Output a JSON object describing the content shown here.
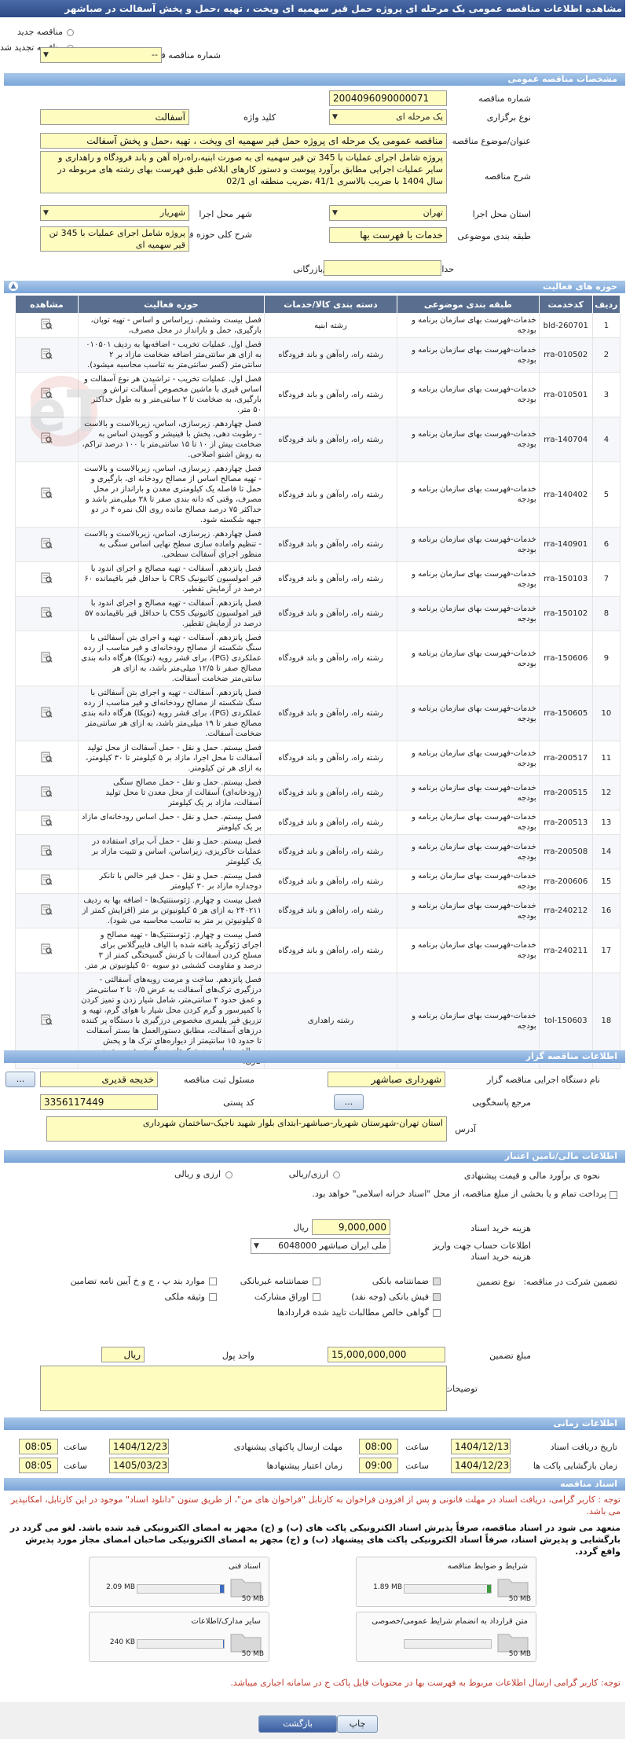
{
  "page_title": "مشاهده اطلاعات مناقصه عمومی یک مرحله ای پروژه حمل قیر سهمیه ای ویخت ، تهیه ،حمل و پخش آسفالت در صباشهر",
  "top": {
    "new_tender_label": "مناقصه جدید",
    "renewed_label": "مناقصه تجدید شده",
    "prev_number_label": "شماره مناقصه قبلی",
    "prev_number_value": "--"
  },
  "general": {
    "section": "مشخصات مناقصه عمومی",
    "number_label": "شماره مناقصه",
    "number_value": "2004096090000071",
    "type_label": "نوع برگزاری",
    "type_value": "یک مرحله ای",
    "keyword_label": "کلید واژه",
    "keyword_value": "آسفالت",
    "subject_label": "عنوان/موضوع مناقصه",
    "subject_value": "مناقصه عمومی یک مرحله ای پروژه حمل قیر سهمیه ای ویخت ، تهیه ،حمل و پخش آسفالت",
    "desc_label": "شرح مناقصه",
    "desc_value": "پروژه شامل اجرای عملیات با 345 تن قیر سهمیه ای به صورت ابنیه،راه،راه آهن و باند فرودگاه و راهداری و سایر عملیات اجرایی مطابق برآورد پیوست و دستور کارهای ابلاغی طبق فهرست بهای رشته های مربوطه در سال 1404 با ضریب بالاسری 41/1 ،ضریب منطقه ای 02/1",
    "province_label": "استان محل اجرا",
    "province_value": "تهران",
    "city_label": "شهر محل اجرا",
    "city_value": "شهریار",
    "category_label": "طبقه بندی موضوعی",
    "category_value": "خدمات با فهرست بها",
    "scope_label": "شرح کلی حوزه فعالیت",
    "scope_value": "پروژه شامل اجرای عملیات با 345 تن قیر سهمیه ای",
    "min_score_label": "حداقل امتیاز قابل قبول ارزیابی فنی/بازرگانی",
    "min_score_value": ""
  },
  "activities": {
    "section": "حوزه های فعالیت",
    "headers": [
      "ردیف",
      "کدخدمت",
      "طبقه بندی موضوعی",
      "دسته بندی کالا/خدمات",
      "حوزه فعالیت",
      "مشاهده"
    ],
    "rows": [
      {
        "idx": "1",
        "code": "bld-260701",
        "cat": "خدمات-فهرست بهای سازمان برنامه و بودجه",
        "grp": "رشته ابنیه",
        "act": "فصل بیست وششم. زیراساس و اساس - تهیه توپان، بارگیری، حمل و بارانداز در محل مصرف،"
      },
      {
        "idx": "2",
        "code": "rra-010502",
        "cat": "خدمات-فهرست بهای سازمان برنامه و بودجه",
        "grp": "رشته راه، راه‌آهن و باند فرودگاه",
        "act": "فصل اول. عملیات تخریب - اضافه‌بها به ردیف ۰۱۰۵۰۱ به ازای هر سانتی‌متر اضافه ضخامت مازاد بر ۲ سانتی‌متر (کسر سانتی‌متر به تناسب محاسبه میشود)."
      },
      {
        "idx": "3",
        "code": "rra-010501",
        "cat": "خدمات-فهرست بهای سازمان برنامه و بودجه",
        "grp": "رشته راه، راه‌آهن و باند فرودگاه",
        "act": "فصل اول. عملیات تخریب - تراشیدن هر نوع آسفالت و اساس قیری با ماشین مخصوص آسفالت تراش و بارگیری، به ضخامت تا ۲ سانتی‌متر و به طول حداکثر ۵۰ متر."
      },
      {
        "idx": "4",
        "code": "rra-140704",
        "cat": "خدمات-فهرست بهای سازمان برنامه و بودجه",
        "grp": "رشته راه، راه‌آهن و باند فرودگاه",
        "act": "فصل چهاردهم. زیرسازی، اساس، زیربالاست و بالاست - رطوبت دهی، پخش با فینیشر و کوبیدن اساس به ضخامت بیش از ۱۰ تا ۱۵ سانتی‌متر با ۱۰۰ درصد تراکم، به روش اشنو اصلاحی."
      },
      {
        "idx": "5",
        "code": "rra-140402",
        "cat": "خدمات-فهرست بهای سازمان برنامه و بودجه",
        "grp": "رشته راه، راه‌آهن و باند فرودگاه",
        "act": "فصل چهاردهم. زیرسازی، اساس، زیربالاست و بالاست - تهیه مصالح اساس از مصالح رودخانه ای، بارگیری و حمل تا فاصله یک کیلومتری معدن و بارانداز در محل مصرف، وقتی که دانه بندی صفر تا ۳۸ میلی‌متر باشد و حداکثر ۷۵ درصد مصالح مانده روی الک نمره ۴ در دو جبهه شکسته شود."
      },
      {
        "idx": "6",
        "code": "rra-140901",
        "cat": "خدمات-فهرست بهای سازمان برنامه و بودجه",
        "grp": "رشته راه، راه‌آهن و باند فرودگاه",
        "act": "فصل چهاردهم. زیرسازی، اساس، زیربالاست و بالاست - تنظیم واماده سازی سطح نهایی اساس سنگی به منظور اجرای آسفالت سطحی."
      },
      {
        "idx": "7",
        "code": "rra-150103",
        "cat": "خدمات-فهرست بهای سازمان برنامه و بودجه",
        "grp": "رشته راه، راه‌آهن و باند فرودگاه",
        "act": "فصل پانزدهم. آسفالت - تهیه مصالح و اجرای اندود با قیر امولسیون کاتیونیک CRS با حداقل قیر باقیمانده ۶۰ درصد در آزمایش تقطیر."
      },
      {
        "idx": "8",
        "code": "rra-150102",
        "cat": "خدمات-فهرست بهای سازمان برنامه و بودجه",
        "grp": "رشته راه، راه‌آهن و باند فرودگاه",
        "act": "فصل پانزدهم. آسفالت - تهیه مصالح و اجرای اندود با قیر امولسیون کاتیونیک CSS با حداقل قیر باقیمانده ۵۷ درصد در آزمایش تقطیر."
      },
      {
        "idx": "9",
        "code": "rra-150606",
        "cat": "خدمات-فهرست بهای سازمان برنامه و بودجه",
        "grp": "رشته راه، راه‌آهن و باند فرودگاه",
        "act": "فصل پانزدهم. آسفالت - تهیه و اجرای بتن آسفالتی با سنگ شکسته از مصالح رودخانه‌ای و قیر مناسب از رده عملکردی (PG)، برای قشر رویه (توپکا) هرگاه دانه بندی مصالح صفر تا ۱۲/۵ میلی‌متر باشد، به ازای هر سانتی‌متر ضخامت آسفالت."
      },
      {
        "idx": "10",
        "code": "rra-150605",
        "cat": "خدمات-فهرست بهای سازمان برنامه و بودجه",
        "grp": "رشته راه، راه‌آهن و باند فرودگاه",
        "act": "فصل پانزدهم. آسفالت - تهیه و اجرای بتن آسفالتی با سنگ شکسته از مصالح رودخانه‌ای و قیر مناسب از رده عملکردی (PG)، برای قشر رویه (توپکا) هرگاه دانه بندی مصالح صفر تا ۱۹ میلی‌متر باشد، به ازای هر سانتی‌متر ضخامت آسفالت."
      },
      {
        "idx": "11",
        "code": "rra-200517",
        "cat": "خدمات-فهرست بهای سازمان برنامه و بودجه",
        "grp": "رشته راه، راه‌آهن و باند فرودگاه",
        "act": "فصل بیستم. حمل و نقل - حمل آسفالت از محل تولید آسفالت تا محل اجرا، مازاد بر ۵ کیلومتر تا ۳۰ کیلومتر، به ازای هر تن کیلومتر."
      },
      {
        "idx": "12",
        "code": "rra-200515",
        "cat": "خدمات-فهرست بهای سازمان برنامه و بودجه",
        "grp": "رشته راه، راه‌آهن و باند فرودگاه",
        "act": "فصل بیستم. حمل و نقل - حمل مصالح سنگی (رودخانه‌ای) آسفالت از محل معدن تا محل تولید آسفالت، مازاد بر یک کیلومتر"
      },
      {
        "idx": "13",
        "code": "rra-200513",
        "cat": "خدمات-فهرست بهای سازمان برنامه و بودجه",
        "grp": "رشته راه، راه‌آهن و باند فرودگاه",
        "act": "فصل بیستم. حمل و نقل - حمل اساس رودخانه‌ای مازاد بر یک کیلومتر"
      },
      {
        "idx": "14",
        "code": "rra-200508",
        "cat": "خدمات-فهرست بهای سازمان برنامه و بودجه",
        "grp": "رشته راه، راه‌آهن و باند فرودگاه",
        "act": "فصل بیستم. حمل و نقل - حمل آب برای استفاده در عملیات خاکریزی، زیراساس، اساس و تثبیت مازاد بر یک کیلومتر"
      },
      {
        "idx": "15",
        "code": "rra-200606",
        "cat": "خدمات-فهرست بهای سازمان برنامه و بودجه",
        "grp": "رشته راه، راه‌آهن و باند فرودگاه",
        "act": "فصل بیستم. حمل و نقل - حمل قیر خالص با تانکر دوجداره مازاد بر ۳۰ کیلومتر"
      },
      {
        "idx": "16",
        "code": "rra-240212",
        "cat": "خدمات-فهرست بهای سازمان برنامه و بودجه",
        "grp": "رشته راه، راه‌آهن و باند فرودگاه",
        "act": "فصل بیست و چهارم. ژئوسنتتیک‌ها - اضافه بها به ردیف ۲۴۰۲۱۱ به ازای هر ۵ کیلونیوتن بر متر (افزایش کمتر از ۵ کیلونیوتن بر متر به تناسب محاسبه می شود)."
      },
      {
        "idx": "17",
        "code": "rra-240211",
        "cat": "خدمات-فهرست بهای سازمان برنامه و بودجه",
        "grp": "رشته راه، راه‌آهن و باند فرودگاه",
        "act": "فصل بیست و چهارم. ژئوسنتتیک‌ها - تهیه مصالح و اجرای ژئوگرید بافته شده با الیاف فایبرگلاس برای مسلح کردن آسفالت با کرنش گسیختگی کمتر از ۳ درصد و مقاومت کششی دو سویه ۵۰ کیلونیوتن بر متر."
      },
      {
        "idx": "18",
        "code": "tol-150603",
        "cat": "خدمات-فهرست بهای سازمان برنامه و بودجه",
        "grp": "رشته راهداری",
        "act": "فصل پانزدهم. ساخت و مرمت رویه‌های آسفالتی - درزگیری ترک‌های آسفالت به عرض ۰/۵ تا ۲ سانتی‌متر و عمق حدود ۲ سانتی‌متر، شامل شیار زدن و تمیز کردن با کمپرسور و گرم کردن محل شیار با هوای گرم، تهیه و تزریق قیر پلیمری مخصوص درزگیری با دستگاه پر کننده درزهای آسفالت، مطابق دستورالعمل ها بستر آسفالت تا حدود ۱۵ سانتیمتر از دیواره‌های ترک ها و پخش مصالح ریزدانه روی ترک‌های درزگیری شده و تمیز کاری."
      }
    ]
  },
  "organizer": {
    "section": "اطلاعات مناقصه گزار",
    "org_label": "نام دستگاه اجرایی مناقصه گزار",
    "org_value": "شهرداری صباشهر",
    "responsible_label": "مسئول ثبت مناقصه",
    "responsible_value": "خدیجه قدیری",
    "ref_label": "مرجع پاسخگویی",
    "postal_label": "کد پستی",
    "postal_value": "3356117449",
    "address_label": "آدرس",
    "address_value": "استان تهران-شهرستان شهریار-صباشهر-ابتدای بلوار شهید ناجیک-ساختمان شهرداری",
    "btn": "..."
  },
  "finance": {
    "section": "اطلاعات مالی/تامین اعتبار",
    "estimate_label": "نحوه ی برآورد مالی و قیمت پیشنهادی",
    "estimate_opt1": "ارزی/ریالی",
    "estimate_opt2": "ارزی و ریالی",
    "payment_label": "پرداخت تمام و یا بخشی از مبلغ مناقصه، از محل \"اسناد خزانه اسلامی\" خواهد بود.",
    "doc_price_label": "هزینه خرید اسناد",
    "doc_price_value": "9,000,000",
    "doc_price_unit": "ریال",
    "account_label": "اطلاعات حساب جهت واریز هزینه خرید اسناد",
    "account_value": "ملی ایران صباشهر 6048000",
    "guarantee_label": "نوع تضمین",
    "guarantee_intro": "تضمین شرکت در مناقصه:",
    "guarantees": [
      "ضمانتنامه بانکی",
      "ضمانتنامه غیربانکی",
      "موارد بند پ ، ج و خ آیین نامه تضامین",
      "فیش بانکی (وجه نقد)",
      "اوراق مشارکت",
      "وثیقه ملکی",
      "گواهی خالص مطالبات تایید شده قراردادها"
    ],
    "amount_label": "مبلغ تضمین",
    "amount_value": "15,000,000,000",
    "unit_label": "واحد پول",
    "unit_value": "ریال",
    "notes_label": "توضیحات",
    "notes_value": ""
  },
  "timing": {
    "section": "اطلاعات زمانی",
    "receive_date_label": "تاریخ دریافت اسناد",
    "receive_date": "1404/12/13",
    "receive_time": "08:00",
    "deadline_label": "مهلت ارسال پاکتهای پیشنهادی",
    "deadline_date": "1404/12/23",
    "deadline_time": "08:05",
    "open_label": "زمان بازگشایی پاکت ها",
    "open_date": "1404/12/23",
    "open_time": "09:00",
    "validity_label": "زمان اعتبار پیشنهادها",
    "validity_date": "1405/03/23",
    "validity_time": "08:05",
    "time_label": "ساعت"
  },
  "docs": {
    "section": "اسناد مناقصه",
    "note1": "توجه : کاربر گرامی، دریافت اسناد در مهلت قانونی و پس از افزودن فراخوان به کارتابل \"فراخوان های من\"، از طریق ستون \"دانلود اسناد\" موجود در این کارتابل، امکانپذیر می باشد.",
    "note2": "متعهد می شود در اسناد مناقصه، صرفاً پذیرش اسناد الکترونیکی پاکت های (ب) و (ج) مجهز به امضای الکترونیکی قید شده باشد. لغو می گردد در بارگشایی و پذیرش اسناد، صرفاً اسناد الکترونیکی پاکت های پیشنهاد (ب) و (ج) مجهز به امضای الکترونیکی صاحبان امضای مجاز مورد پذیرش واقع گردد.",
    "files": [
      {
        "title": "شرایط و ضوابط مناقصه",
        "size": "1.89 MB",
        "limit": "50 MB"
      },
      {
        "title": "اسناد فنی",
        "size": "2.09 MB",
        "limit": "50 MB"
      },
      {
        "title": "متن قرارداد به انضمام شرایط عمومی/خصوصی",
        "size": "",
        "limit": "50 MB"
      },
      {
        "title": "سایر مدارک/اطلاعات",
        "size": "240 KB",
        "limit": "50 MB"
      }
    ],
    "note3": "توجه: کاربر گرامی ارسال اطلاعات مربوط به فهرست بها در محتویات فایل پاکت ج در سامانه اجباری میباشد."
  },
  "footer": {
    "print_label": "چاپ",
    "back_label": "بازگشت"
  },
  "watermark": "Tender.neT",
  "colors": {
    "header": "#3b5a96",
    "section": "#8ab0e0",
    "field": "#fffcc0",
    "table_header": "#5a6f8f"
  }
}
